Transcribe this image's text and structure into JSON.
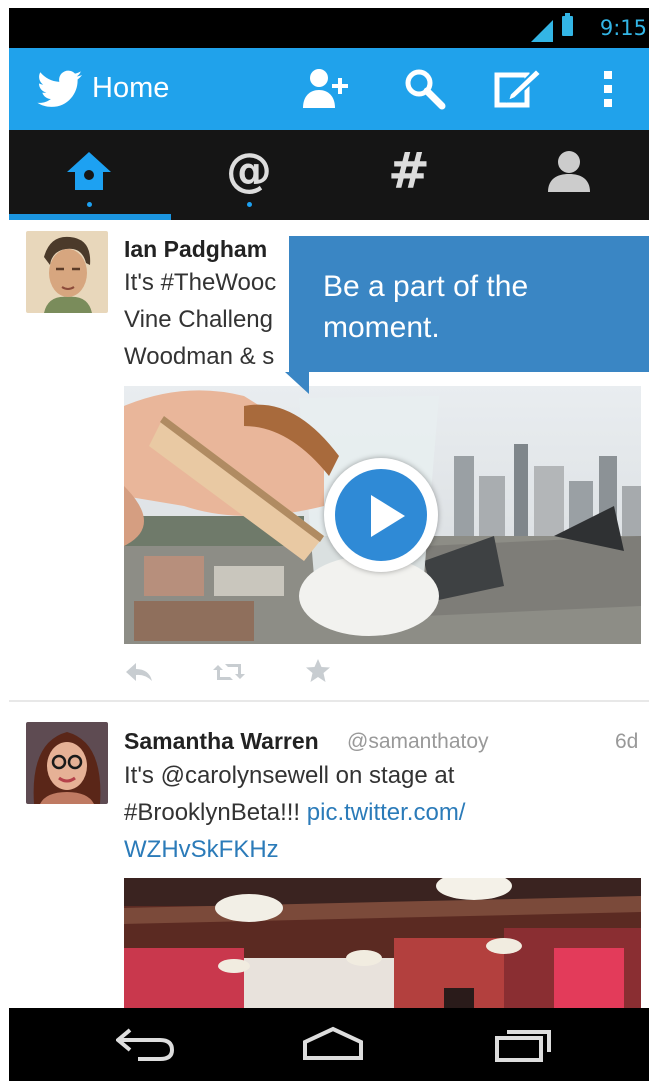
{
  "status_bar": {
    "time": "9:15"
  },
  "app_bar": {
    "title": "Home"
  },
  "tabs": [
    {
      "name": "home",
      "active": true
    },
    {
      "name": "connect",
      "active": false
    },
    {
      "name": "discover",
      "active": false
    },
    {
      "name": "me",
      "active": false
    }
  ],
  "tooltip": {
    "text": "Be a part of the moment."
  },
  "tweets": [
    {
      "name": "Ian Padgham",
      "text_lines": [
        "It's #TheWooc",
        "Vine Challeng",
        "Woodman & s"
      ]
    },
    {
      "name": "Samantha Warren",
      "handle": "@samanthatoy",
      "time": "6d",
      "text_lines": [
        "It's @carolynsewell on stage at"
      ],
      "text_line2_prefix": "#BrooklynBeta!!! ",
      "link_line1": "pic.twitter.com/",
      "link_line2": "WZHvSkFKHz"
    }
  ],
  "colors": {
    "accent": "#20a2eb",
    "tab_bar": "#151515",
    "tooltip": "#3a86c4",
    "link": "#2b7bb9"
  },
  "icons": [
    "twitter-bird-icon",
    "add-user-icon",
    "search-icon",
    "compose-icon",
    "overflow-menu-icon",
    "home-icon",
    "mention-icon",
    "hashtag-icon",
    "profile-icon",
    "reply-icon",
    "retweet-icon",
    "favorite-icon",
    "back-icon",
    "home-nav-icon",
    "recents-icon",
    "play-icon"
  ]
}
